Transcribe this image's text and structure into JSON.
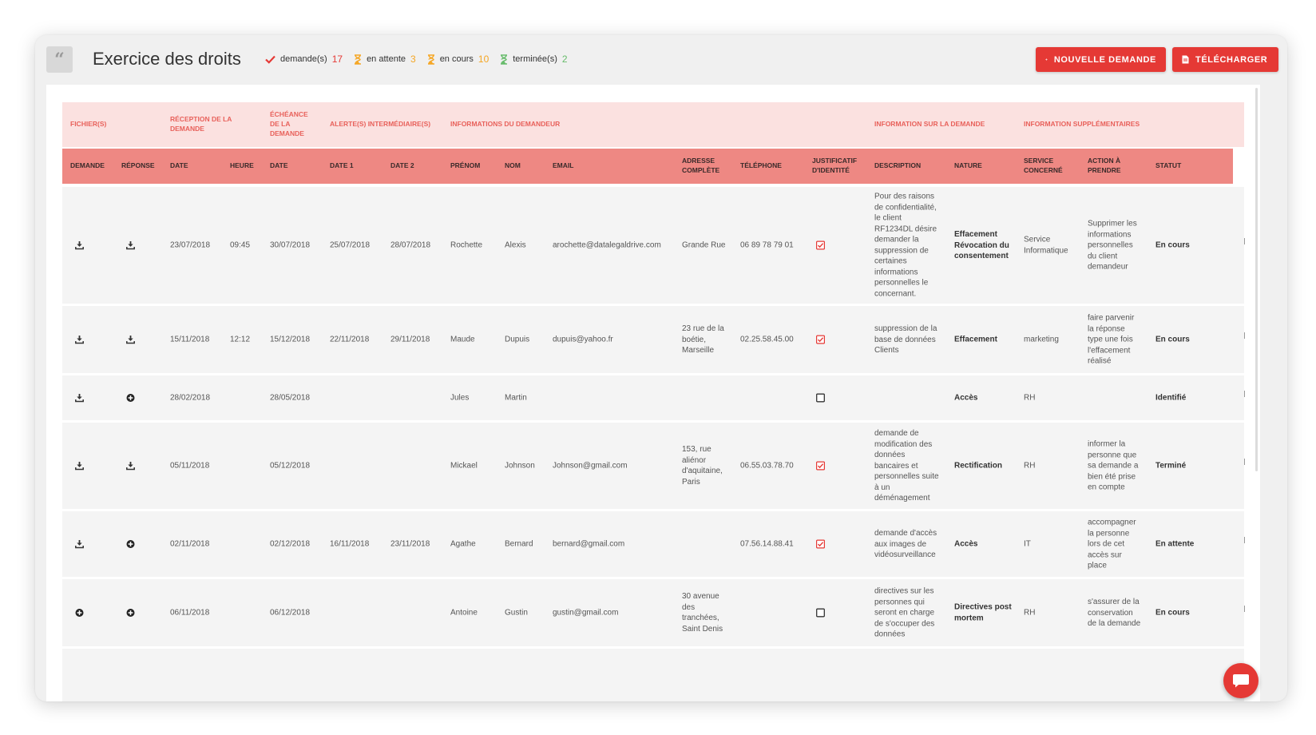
{
  "page": {
    "title": "Exercice des droits",
    "colors": {
      "accent": "#e53935",
      "group_header_bg": "#fbe1e0",
      "column_header_bg": "#ee8883",
      "row_bg": "#f4f4f4"
    }
  },
  "stats": [
    {
      "label": "demande(s)",
      "count": "17",
      "icon": "check-icon",
      "color": "#e53935"
    },
    {
      "label": "en attente",
      "count": "3",
      "icon": "hourglass-icon",
      "color": "#f5a623"
    },
    {
      "label": "en cours",
      "count": "10",
      "icon": "hourglass-icon",
      "color": "#f5a623"
    },
    {
      "label": "terminée(s)",
      "count": "2",
      "icon": "hourglass-icon",
      "color": "#66bb6a"
    }
  ],
  "buttons": {
    "new_request": "NOUVELLE DEMANDE",
    "download": "TÉLÉCHARGER"
  },
  "group_headers": {
    "files": "FICHIER(S)",
    "reception": "RÉCEPTION DE LA DEMANDE",
    "deadline": "ÉCHÉANCE DE LA DEMANDE",
    "alerts": "ALERTE(S) INTERMÉDIAIRE(S)",
    "requester": "INFORMATIONS DU DEMANDEUR",
    "request_info": "INFORMATION SUR LA DEMANDE",
    "extra": "INFORMATION SUPPLÉMENTAIRES"
  },
  "columns": {
    "demande": "DEMANDE",
    "reponse": "RÉPONSE",
    "date": "DATE",
    "heure": "HEURE",
    "date_deadline": "DATE",
    "date1": "DATE 1",
    "date2": "DATE 2",
    "prenom": "PRÉNOM",
    "nom": "NOM",
    "email": "EMAIL",
    "adresse": "ADRESSE COMPLÈTE",
    "telephone": "TÉLÉPHONE",
    "justificatif": "JUSTIFICATIF D'IDENTITÉ",
    "description": "DESCRIPTION",
    "nature": "NATURE",
    "service": "SERVICE CONCERNÉ",
    "action": "ACTION À PRENDRE",
    "statut": "STATUT"
  },
  "rows": [
    {
      "demande_icon": "download-icon",
      "reponse_icon": "download-icon",
      "date": "23/07/2018",
      "heure": "09:45",
      "echeance": "30/07/2018",
      "date1": "25/07/2018",
      "date2": "28/07/2018",
      "prenom": "Rochette",
      "nom": "Alexis",
      "email": "arochette@datalegaldrive.com",
      "adresse": "Grande Rue",
      "telephone": "06 89 78 79 01",
      "justificatif": true,
      "description": "Pour des raisons de confidentialité, le client RF1234DL désire demander la suppression de certaines informations personnelles le concernant.",
      "nature": "Effacement Révocation du consentement",
      "service": "Service Informatique",
      "action": "Supprimer les informations personnelles du client demandeur",
      "statut": "En cours"
    },
    {
      "demande_icon": "download-icon",
      "reponse_icon": "download-icon",
      "date": "15/11/2018",
      "heure": "12:12",
      "echeance": "15/12/2018",
      "date1": "22/11/2018",
      "date2": "29/11/2018",
      "prenom": "Maude",
      "nom": "Dupuis",
      "email": "dupuis@yahoo.fr",
      "adresse": "23 rue de la boétie, Marseille",
      "telephone": "02.25.58.45.00",
      "justificatif": true,
      "description": "suppression de la base de données Clients",
      "nature": "Effacement",
      "service": "marketing",
      "action": "faire parvenir la réponse type une fois l'effacement réalisé",
      "statut": "En cours"
    },
    {
      "demande_icon": "download-icon",
      "reponse_icon": "plus-circle-icon",
      "date": "28/02/2018",
      "heure": "",
      "echeance": "28/05/2018",
      "date1": "",
      "date2": "",
      "prenom": "Jules",
      "nom": "Martin",
      "email": "",
      "adresse": "",
      "telephone": "",
      "justificatif": false,
      "description": "",
      "nature": "Accès",
      "service": "RH",
      "action": "",
      "statut": "Identifié"
    },
    {
      "demande_icon": "download-icon",
      "reponse_icon": "download-icon",
      "date": "05/11/2018",
      "heure": "",
      "echeance": "05/12/2018",
      "date1": "",
      "date2": "",
      "prenom": "Mickael",
      "nom": "Johnson",
      "email": "Johnson@gmail.com",
      "adresse": "153, rue aliénor d'aquitaine, Paris",
      "telephone": "06.55.03.78.70",
      "justificatif": true,
      "description": "demande de modification des données bancaires et personnelles suite à un déménagement",
      "nature": "Rectification",
      "service": "RH",
      "action": "informer la personne que sa demande a bien été prise en compte",
      "statut": "Terminé"
    },
    {
      "demande_icon": "download-icon",
      "reponse_icon": "plus-circle-icon",
      "date": "02/11/2018",
      "heure": "",
      "echeance": "02/12/2018",
      "date1": "16/11/2018",
      "date2": "23/11/2018",
      "prenom": "Agathe",
      "nom": "Bernard",
      "email": "bernard@gmail.com",
      "adresse": "",
      "telephone": "07.56.14.88.41",
      "justificatif": true,
      "description": "demande d'accès aux images de vidéosurveillance",
      "nature": "Accès",
      "service": "IT",
      "action": "accompagner la personne lors de cet accès sur place",
      "statut": "En attente"
    },
    {
      "demande_icon": "plus-circle-icon",
      "reponse_icon": "plus-circle-icon",
      "date": "06/11/2018",
      "heure": "",
      "echeance": "06/12/2018",
      "date1": "",
      "date2": "",
      "prenom": "Antoine",
      "nom": "Gustin",
      "email": "gustin@gmail.com",
      "adresse": "30 avenue des tranchées, Saint Denis",
      "telephone": "",
      "justificatif": false,
      "description": "directives sur les personnes qui seront en charge de s'occuper des données",
      "nature": "Directives post mortem",
      "service": "RH",
      "action": "s'assurer de la conservation de la demande",
      "statut": "En cours"
    }
  ]
}
